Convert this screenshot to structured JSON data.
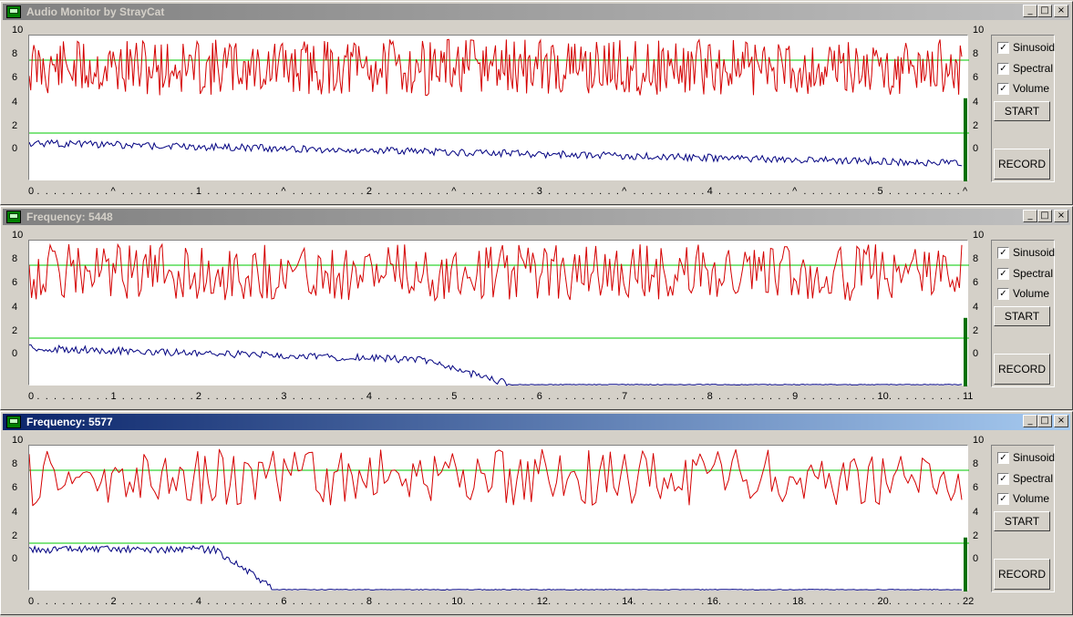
{
  "windows": [
    {
      "title": "Audio Monitor by StrayCat",
      "active": false,
      "x_ticks": [
        "0",
        "^",
        "1",
        "^",
        "2",
        "^",
        "3",
        "^",
        "4",
        "^",
        "5",
        "^"
      ],
      "y_ticks": [
        "10",
        "8",
        "6",
        "4",
        "2",
        "0"
      ],
      "volume_level": 0.57,
      "seed": 11,
      "blue_profile": "flat-decay"
    },
    {
      "title": "Frequency: 5448",
      "active": false,
      "x_ticks": [
        "0",
        "1",
        "2",
        "3",
        "4",
        "5",
        "6",
        "7",
        "8",
        "9",
        "10",
        "11"
      ],
      "y_ticks": [
        "10",
        "8",
        "6",
        "4",
        "2",
        "0"
      ],
      "volume_level": 0.47,
      "seed": 29,
      "blue_profile": "drop-mid"
    },
    {
      "title": "Frequency: 5577",
      "active": true,
      "x_ticks": [
        "0",
        "2",
        "4",
        "6",
        "8",
        "10",
        "12",
        "14",
        "16",
        "18",
        "20",
        "22"
      ],
      "y_ticks": [
        "10",
        "8",
        "6",
        "4",
        "2",
        "0"
      ],
      "volume_level": 0.37,
      "seed": 47,
      "blue_profile": "drop-early"
    }
  ],
  "controls": {
    "sinusoid_label": "Sinusoid",
    "spectral_label": "Spectral",
    "volume_label": "Volume",
    "start_label": "START",
    "record_label": "RECORD",
    "check_mark": "✓"
  },
  "colors": {
    "red_trace": "#d40000",
    "blue_trace": "#000080",
    "ref_line": "#00c800",
    "volume_bar": "#007000"
  }
}
